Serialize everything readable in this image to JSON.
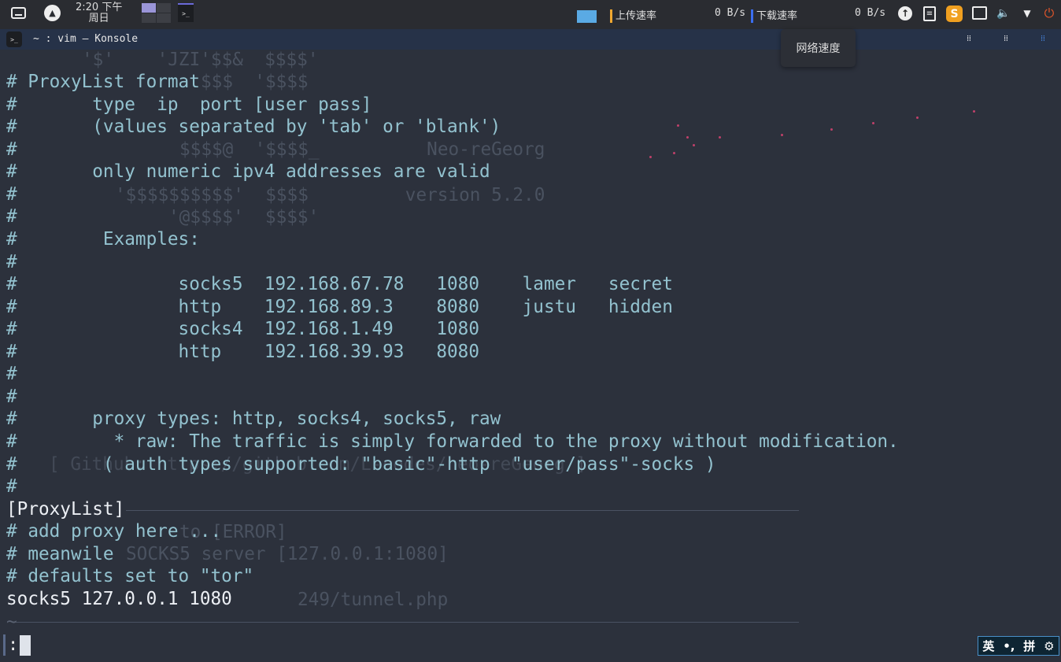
{
  "panel": {
    "time": "2:20 下午",
    "day": "周日",
    "upload_label": "上传速率",
    "upload_value": "0 B/s",
    "download_label": "下载速率",
    "download_value": "0 B/s",
    "tooltip": "网络速度",
    "colors": {
      "upload": "#f0a830",
      "download": "#3b6ef0"
    }
  },
  "window": {
    "title": "~ : vim — Konsole"
  },
  "editor": {
    "lines": [
      {
        "t": "# ProxyList format",
        "k": "c"
      },
      {
        "t": "#       type  ip  port [user pass]",
        "k": "c"
      },
      {
        "t": "#       (values separated by 'tab' or 'blank')",
        "k": "c"
      },
      {
        "t": "#",
        "k": "c"
      },
      {
        "t": "#       only numeric ipv4 addresses are valid",
        "k": "c"
      },
      {
        "t": "#",
        "k": "c"
      },
      {
        "t": "#",
        "k": "c"
      },
      {
        "t": "#        Examples:",
        "k": "c"
      },
      {
        "t": "#",
        "k": "c"
      },
      {
        "t": "#               socks5  192.168.67.78   1080    lamer   secret",
        "k": "c"
      },
      {
        "t": "#               http    192.168.89.3    8080    justu   hidden",
        "k": "c"
      },
      {
        "t": "#               socks4  192.168.1.49    1080",
        "k": "c"
      },
      {
        "t": "#               http    192.168.39.93   8080",
        "k": "c"
      },
      {
        "t": "#",
        "k": "c"
      },
      {
        "t": "#",
        "k": "c"
      },
      {
        "t": "#       proxy types: http, socks4, socks5, raw",
        "k": "c"
      },
      {
        "t": "#         * raw: The traffic is simply forwarded to the proxy without modification.",
        "k": "c"
      },
      {
        "t": "#        ( auth types supported: \"basic\"-http  \"user/pass\"-socks )",
        "k": "c"
      },
      {
        "t": "#",
        "k": "c"
      },
      {
        "t": "[ProxyList]",
        "k": "w"
      },
      {
        "t": "# add proxy here ...",
        "k": "c"
      },
      {
        "t": "# meanwile",
        "k": "c"
      },
      {
        "t": "# defaults set to \"tor\"",
        "k": "c"
      },
      {
        "t": "socks5 127.0.0.1 1080",
        "k": "w"
      },
      {
        "t": "~",
        "k": "g"
      }
    ],
    "command": ":"
  },
  "background_text": {
    "l1": "'$'    'JZI'$$&  $$$$'",
    "l2": "$$$  '$$$$",
    "l3": "$$$$@  '$$$$_          Neo-reGeorg",
    "l4": "'$$$$$$$$$$'  $$$$         version 5.2.0",
    "l5": "'@$$$$'  $$$$'",
    "l6": "[ Github: https://github.com/L-codes/neo-reGeorg ]",
    "l7": "to [ERROR]",
    "l8": "SOCKS5 server [127.0.0.1:1080]",
    "l9": "249/tunnel.php"
  },
  "ime": {
    "lang": "英",
    "punct": "•,",
    "mode": "拼",
    "settings": "⚙"
  }
}
